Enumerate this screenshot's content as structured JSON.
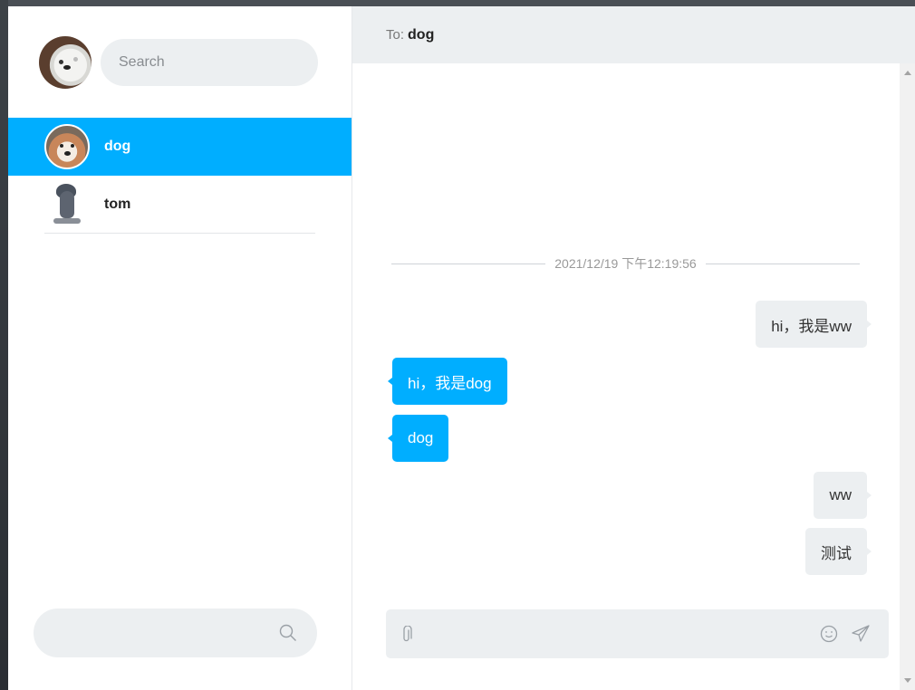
{
  "me": {
    "avatar": "polar-bear-avatar"
  },
  "search_top": {
    "placeholder": "Search"
  },
  "contacts": [
    {
      "name": "dog",
      "avatar": "husky-avatar",
      "active": true
    },
    {
      "name": "tom",
      "avatar": "tom-cat-avatar",
      "active": false
    }
  ],
  "search_bottom": {
    "icon": "search-icon"
  },
  "header": {
    "to_label": "To:",
    "recipient": "dog"
  },
  "chat": {
    "timestamp": "2021/12/19 下午12:19:56",
    "messages": [
      {
        "from": "me",
        "text": "hi，我是ww"
      },
      {
        "from": "dog",
        "text": "hi，我是dog"
      },
      {
        "from": "dog",
        "text": "dog"
      },
      {
        "from": "me",
        "text": "ww"
      },
      {
        "from": "me",
        "text": "测试"
      }
    ]
  },
  "composer": {
    "value": "",
    "icons": [
      "paperclip-icon",
      "emoji-icon",
      "send-icon"
    ]
  },
  "colors": {
    "accent": "#00aeff",
    "panel": "#eceff1"
  }
}
